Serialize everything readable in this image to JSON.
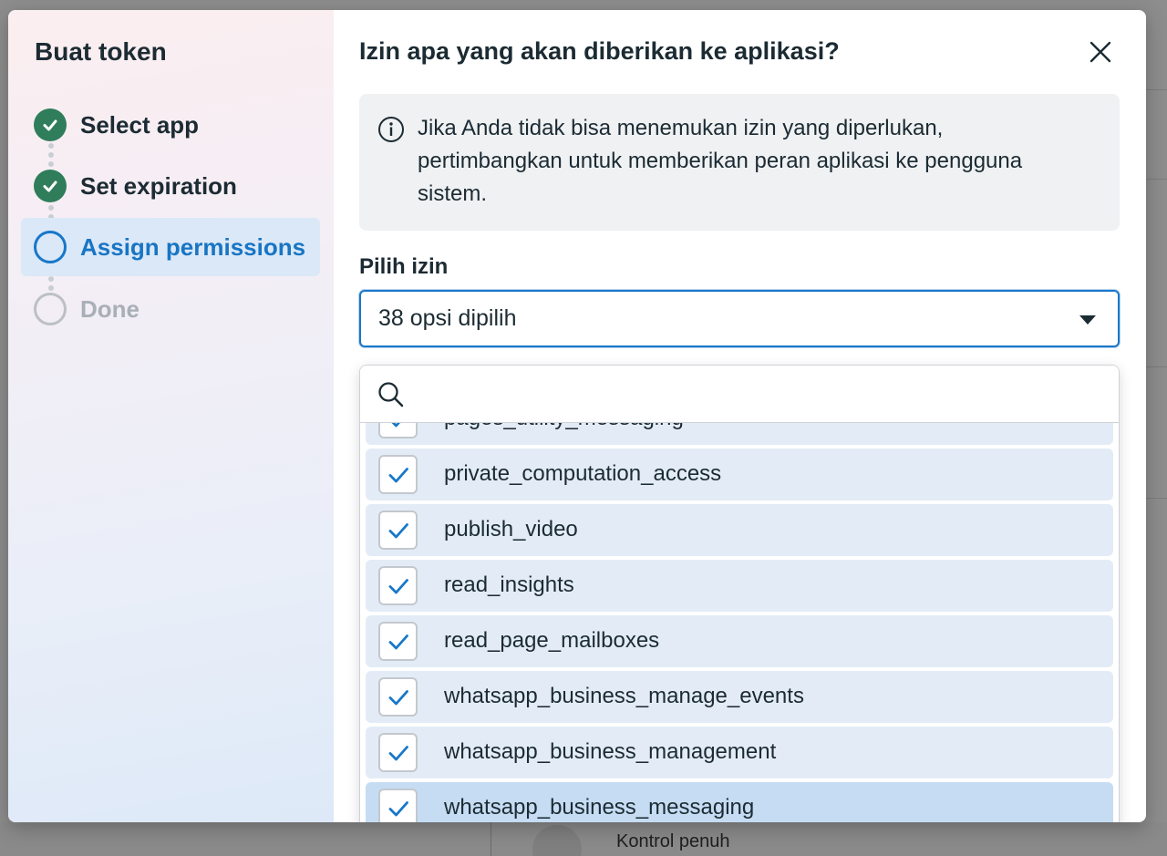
{
  "background": {
    "footer_text": "Kontrol penuh"
  },
  "sidebar": {
    "title": "Buat token",
    "steps": [
      {
        "label": "Select app",
        "state": "done"
      },
      {
        "label": "Set expiration",
        "state": "done"
      },
      {
        "label": "Assign permissions",
        "state": "current"
      },
      {
        "label": "Done",
        "state": "pending"
      }
    ]
  },
  "main": {
    "title": "Izin apa yang akan diberikan ke aplikasi?",
    "info_text": "Jika Anda tidak bisa menemukan izin yang diperlukan, pertimbangkan untuk memberikan peran aplikasi ke pengguna sistem.",
    "field_label": "Pilih izin",
    "select_value": "38 opsi dipilih",
    "search": {
      "value": ""
    },
    "options": [
      {
        "label": "pages_utility_messaging",
        "checked": true,
        "highlighted": false
      },
      {
        "label": "private_computation_access",
        "checked": true,
        "highlighted": false
      },
      {
        "label": "publish_video",
        "checked": true,
        "highlighted": false
      },
      {
        "label": "read_insights",
        "checked": true,
        "highlighted": false
      },
      {
        "label": "read_page_mailboxes",
        "checked": true,
        "highlighted": false
      },
      {
        "label": "whatsapp_business_manage_events",
        "checked": true,
        "highlighted": false
      },
      {
        "label": "whatsapp_business_management",
        "checked": true,
        "highlighted": false
      },
      {
        "label": "whatsapp_business_messaging",
        "checked": true,
        "highlighted": true
      }
    ]
  },
  "colors": {
    "accent": "#1877c9",
    "done_green": "#2f7d5b",
    "check_blue": "#1877c9"
  }
}
